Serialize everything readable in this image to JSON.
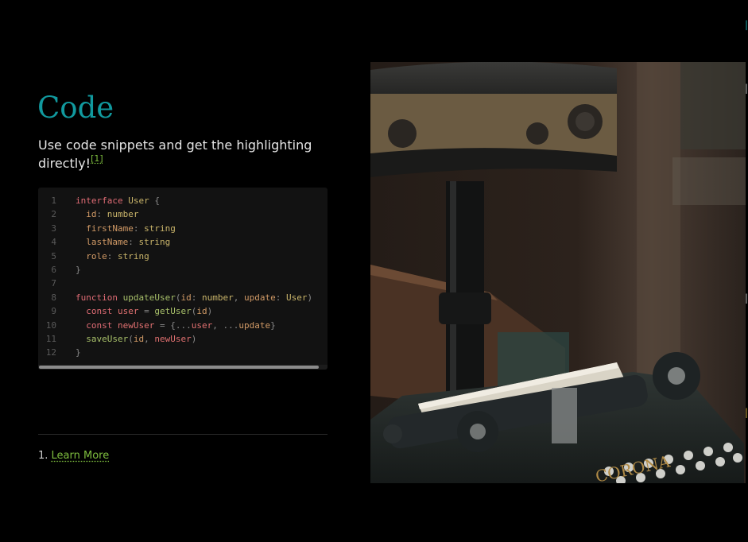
{
  "slide": {
    "title": "Code",
    "description": "Use code snippets and get the highlighting directly!",
    "footnote_ref": "[1]"
  },
  "code": {
    "language": "typescript",
    "lines": [
      {
        "n": "1",
        "tokens": [
          {
            "t": "interface ",
            "c": "kw"
          },
          {
            "t": "User",
            "c": "ty"
          },
          {
            "t": " {",
            "c": "p"
          }
        ]
      },
      {
        "n": "2",
        "tokens": [
          {
            "t": "  id",
            "c": "pr"
          },
          {
            "t": ": ",
            "c": "p"
          },
          {
            "t": "number",
            "c": "ty"
          }
        ]
      },
      {
        "n": "3",
        "tokens": [
          {
            "t": "  firstName",
            "c": "pr"
          },
          {
            "t": ": ",
            "c": "p"
          },
          {
            "t": "string",
            "c": "ty"
          }
        ]
      },
      {
        "n": "4",
        "tokens": [
          {
            "t": "  lastName",
            "c": "pr"
          },
          {
            "t": ": ",
            "c": "p"
          },
          {
            "t": "string",
            "c": "ty"
          }
        ]
      },
      {
        "n": "5",
        "tokens": [
          {
            "t": "  role",
            "c": "pr"
          },
          {
            "t": ": ",
            "c": "p"
          },
          {
            "t": "string",
            "c": "ty"
          }
        ]
      },
      {
        "n": "6",
        "tokens": [
          {
            "t": "}",
            "c": "p"
          }
        ]
      },
      {
        "n": "7",
        "tokens": []
      },
      {
        "n": "8",
        "tokens": [
          {
            "t": "function ",
            "c": "kw"
          },
          {
            "t": "updateUser",
            "c": "fn"
          },
          {
            "t": "(",
            "c": "p"
          },
          {
            "t": "id",
            "c": "pr"
          },
          {
            "t": ": ",
            "c": "p"
          },
          {
            "t": "number",
            "c": "ty"
          },
          {
            "t": ", ",
            "c": "p"
          },
          {
            "t": "update",
            "c": "pr"
          },
          {
            "t": ": ",
            "c": "p"
          },
          {
            "t": "User",
            "c": "ty"
          },
          {
            "t": ")",
            "c": "p"
          }
        ]
      },
      {
        "n": "9",
        "tokens": [
          {
            "t": "  const ",
            "c": "kw"
          },
          {
            "t": "user",
            "c": "v"
          },
          {
            "t": " = ",
            "c": "p"
          },
          {
            "t": "getUser",
            "c": "fn"
          },
          {
            "t": "(",
            "c": "p"
          },
          {
            "t": "id",
            "c": "pr"
          },
          {
            "t": ")",
            "c": "p"
          }
        ]
      },
      {
        "n": "10",
        "tokens": [
          {
            "t": "  const ",
            "c": "kw"
          },
          {
            "t": "newUser",
            "c": "v"
          },
          {
            "t": " = {...",
            "c": "p"
          },
          {
            "t": "user",
            "c": "v"
          },
          {
            "t": ", ...",
            "c": "p"
          },
          {
            "t": "update",
            "c": "pr"
          },
          {
            "t": "}",
            "c": "p"
          }
        ]
      },
      {
        "n": "11",
        "tokens": [
          {
            "t": "  saveUser",
            "c": "fn"
          },
          {
            "t": "(",
            "c": "p"
          },
          {
            "t": "id",
            "c": "pr"
          },
          {
            "t": ", ",
            "c": "p"
          },
          {
            "t": "newUser",
            "c": "v"
          },
          {
            "t": ")",
            "c": "p"
          }
        ]
      },
      {
        "n": "12",
        "tokens": [
          {
            "t": "}",
            "c": "p"
          }
        ]
      }
    ]
  },
  "footnotes": {
    "items": [
      {
        "number": "1.",
        "link_text": "Learn More"
      }
    ]
  },
  "image": {
    "description_icon": "typewriter-photo",
    "brand_text": "CORONA"
  },
  "colors": {
    "background": "#000000",
    "title": "#11999e",
    "link": "#7fbf3f",
    "code_bg": "#121212"
  }
}
